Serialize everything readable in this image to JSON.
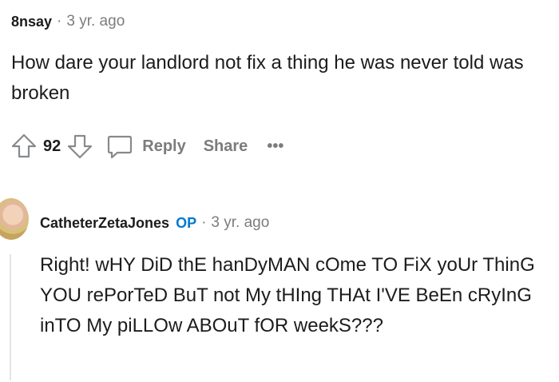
{
  "comment1": {
    "username": "8nsay",
    "separator": "·",
    "timestamp": "3 yr. ago",
    "text": "How dare your landlord not fix a thing he was never told was broken",
    "score": "92",
    "actions": {
      "reply": "Reply",
      "share": "Share",
      "more": "•••"
    }
  },
  "comment2": {
    "username": "CatheterZetaJones",
    "badge": "OP",
    "separator": "·",
    "timestamp": "3 yr. ago",
    "text": "Right! wHY DiD thE hanDyMAN cOme TO FiX yoUr ThinG YOU rePorTeD BuT not My tHIng THAt I'VE BeEn cRyInG inTO My piLLOw ABOuT fOR weekS???"
  },
  "icons": [
    "upvote-icon",
    "downvote-icon",
    "comment-bubble-icon",
    "more-icon"
  ],
  "colors": {
    "op_badge": "#0079d3",
    "meta_gray": "#7c7c7c",
    "text": "#1c1c1c"
  }
}
